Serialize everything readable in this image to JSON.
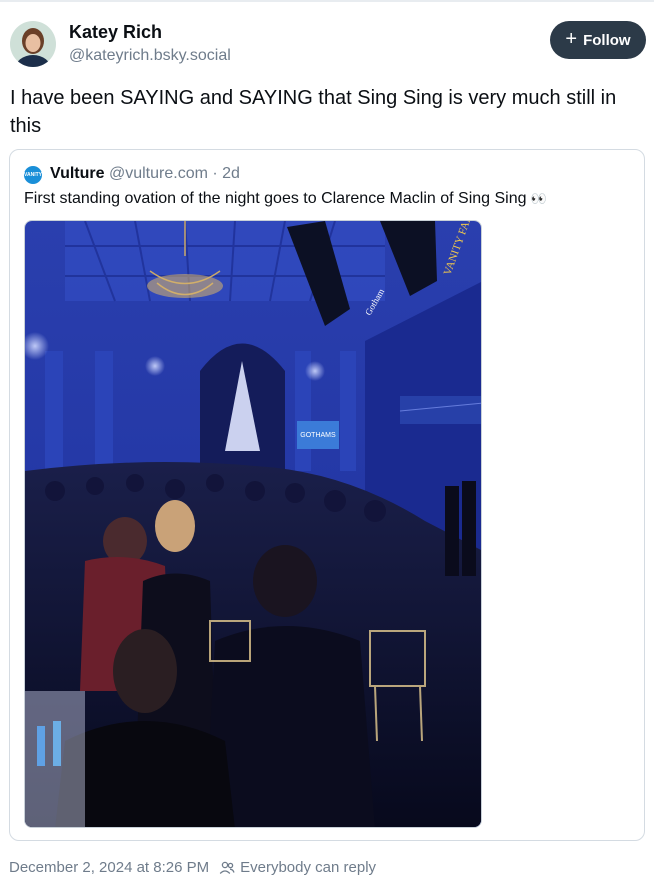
{
  "author": {
    "display_name": "Katey Rich",
    "handle": "@kateyrich.bsky.social"
  },
  "follow_button": {
    "label": "Follow",
    "icon": "plus-icon"
  },
  "post": {
    "text": "I have been SAYING and SAYING that Sing Sing is very much still in this",
    "timestamp": "December 2, 2024 at 8:26 PM",
    "reply_setting": "Everybody can reply"
  },
  "quote": {
    "avatar_text": "VANITY",
    "author_name": "Vulture",
    "handle": "@vulture.com",
    "separator": "·",
    "time": "2d",
    "text": "First standing ovation of the night goes to Clarence Maclin of Sing Sing",
    "emoji": "👀"
  },
  "image_scene": {
    "screen_text": "GOTHAMS",
    "banner_text": "VANITY FAIR",
    "side_sign": "Gotham"
  },
  "colors": {
    "follow_bg": "#2c3a48",
    "muted_text": "#6f7c8b",
    "border": "#d4dbe2",
    "venue_blue": "#2233aa"
  }
}
